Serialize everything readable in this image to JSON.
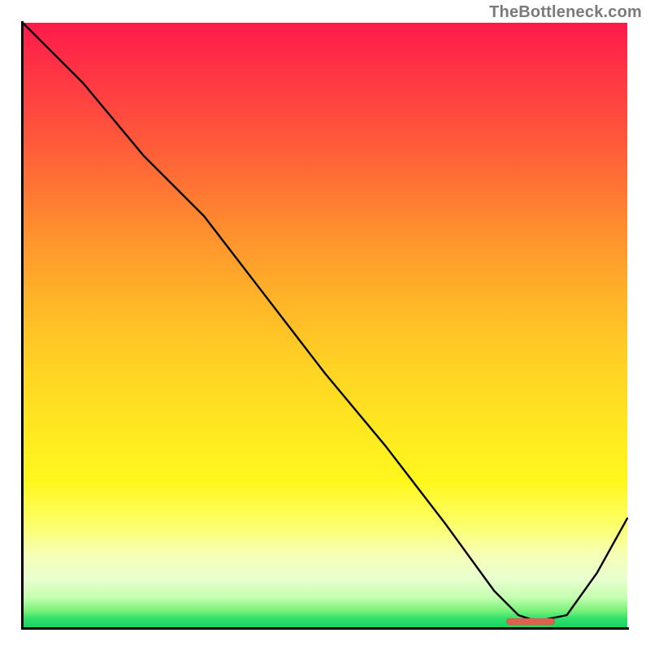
{
  "attribution": "TheBottleneck.com",
  "chart_data": {
    "type": "line",
    "title": "",
    "xlabel": "",
    "ylabel": "",
    "xlim": [
      0,
      100
    ],
    "ylim": [
      0,
      100
    ],
    "x": [
      0,
      5,
      10,
      15,
      20,
      25,
      30,
      40,
      50,
      60,
      70,
      78,
      82,
      85,
      90,
      95,
      100
    ],
    "y": [
      100,
      95,
      90,
      84,
      78,
      73,
      68,
      55,
      42,
      30,
      17,
      6,
      2,
      1,
      2,
      9,
      18
    ],
    "optimum_band": {
      "x_start": 80,
      "x_end": 88,
      "y": 1
    },
    "background_gradient": {
      "top": "#ff1a4b",
      "mid": "#ffe920",
      "bottom": "#16d362"
    }
  }
}
